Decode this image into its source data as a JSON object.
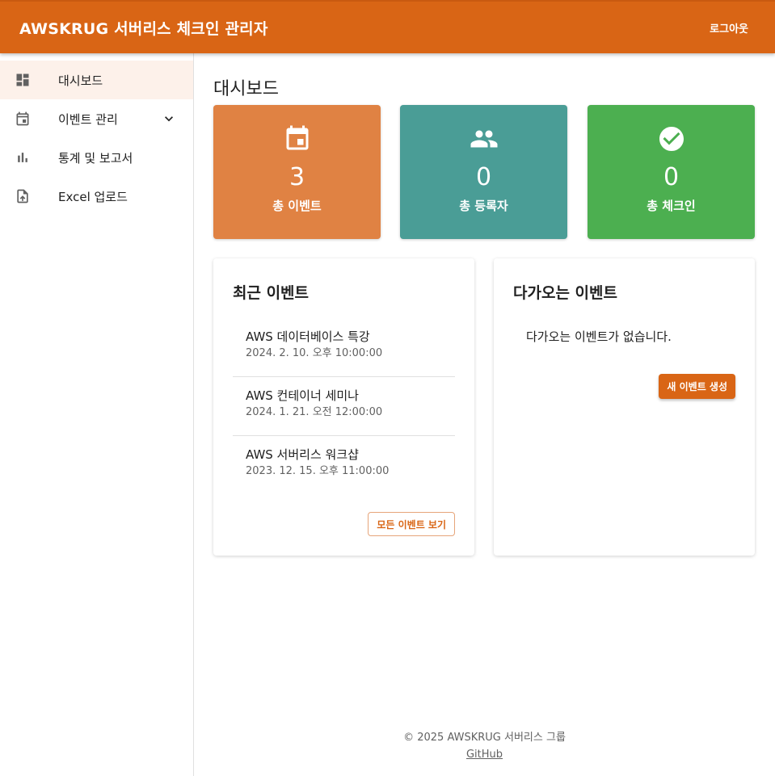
{
  "appbar": {
    "title": "AWSKRUG 서버리스 체크인 관리자",
    "logout_label": "로그아웃"
  },
  "sidebar": {
    "items": [
      {
        "label": "대시보드",
        "icon": "dashboard-icon",
        "active": true
      },
      {
        "label": "이벤트 관리",
        "icon": "calendar-icon",
        "expandable": true
      },
      {
        "label": "통계 및 보고서",
        "icon": "bar-chart-icon"
      },
      {
        "label": "Excel 업로드",
        "icon": "upload-file-icon"
      }
    ]
  },
  "main": {
    "title": "대시보드",
    "stats": [
      {
        "value": "3",
        "label": "총 이벤트",
        "icon": "event-icon",
        "color": "#e08243"
      },
      {
        "value": "0",
        "label": "총 등록자",
        "icon": "people-icon",
        "color": "#4a9d96"
      },
      {
        "value": "0",
        "label": "총 체크인",
        "icon": "check-circle-icon",
        "color": "#4caf50"
      }
    ],
    "recent": {
      "title": "최근 이벤트",
      "events": [
        {
          "name": "AWS 데이터베이스 특강",
          "date": "2024. 2. 10. 오후 10:00:00"
        },
        {
          "name": "AWS 컨테이너 세미나",
          "date": "2024. 1. 21. 오전 12:00:00"
        },
        {
          "name": "AWS 서버리스 워크샵",
          "date": "2023. 12. 15. 오후 11:00:00"
        }
      ],
      "view_all_label": "모든 이벤트 보기"
    },
    "upcoming": {
      "title": "다가오는 이벤트",
      "empty_message": "다가오는 이벤트가 없습니다.",
      "create_label": "새 이벤트 생성"
    }
  },
  "footer": {
    "copyright": "© 2025 AWSKRUG 서버리스 그룹",
    "link_label": "GitHub"
  },
  "colors": {
    "brand": "#d96515",
    "active_nav_bg": "#fdf1ea"
  }
}
